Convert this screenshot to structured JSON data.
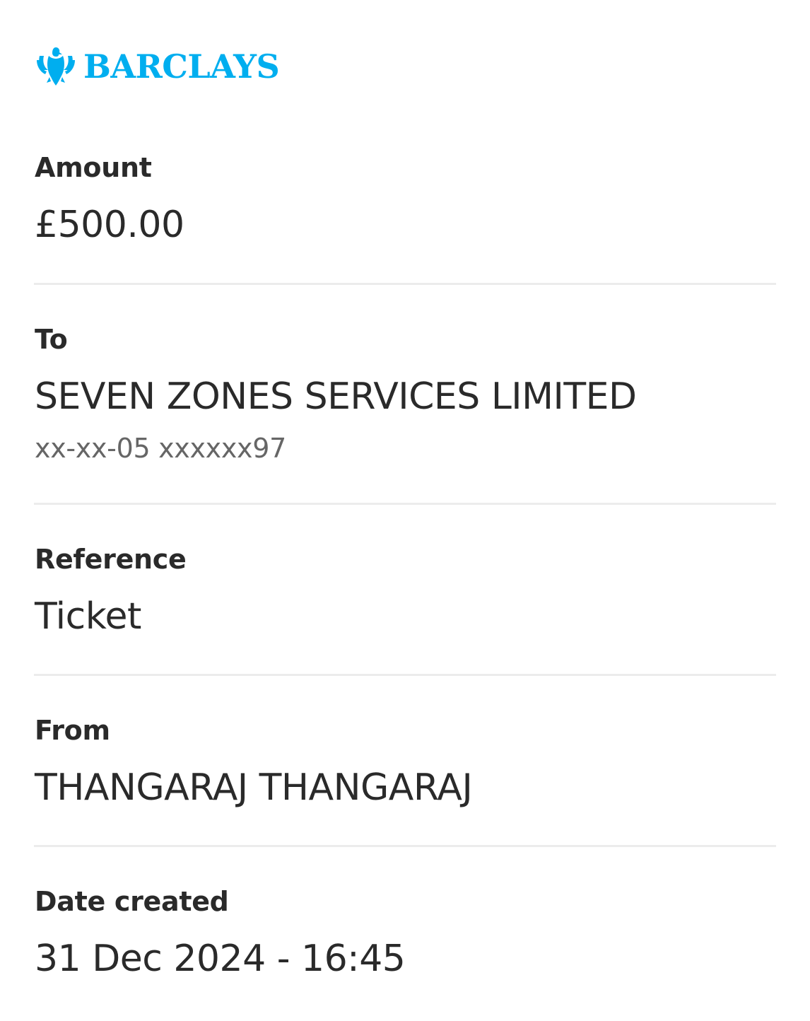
{
  "brand": {
    "name": "BARCLAYS",
    "color": "#00aeef",
    "icon": "eagle-icon"
  },
  "details": {
    "amount": {
      "label": "Amount",
      "value": "£500.00"
    },
    "to": {
      "label": "To",
      "value": "SEVEN ZONES SERVICES LIMITED",
      "account": "xx-xx-05 xxxxxx97"
    },
    "reference": {
      "label": "Reference",
      "value": "Ticket"
    },
    "from": {
      "label": "From",
      "value": "THANGARAJ THANGARAJ"
    },
    "date_created": {
      "label": "Date created",
      "value": "31 Dec 2024 - 16:45"
    }
  }
}
